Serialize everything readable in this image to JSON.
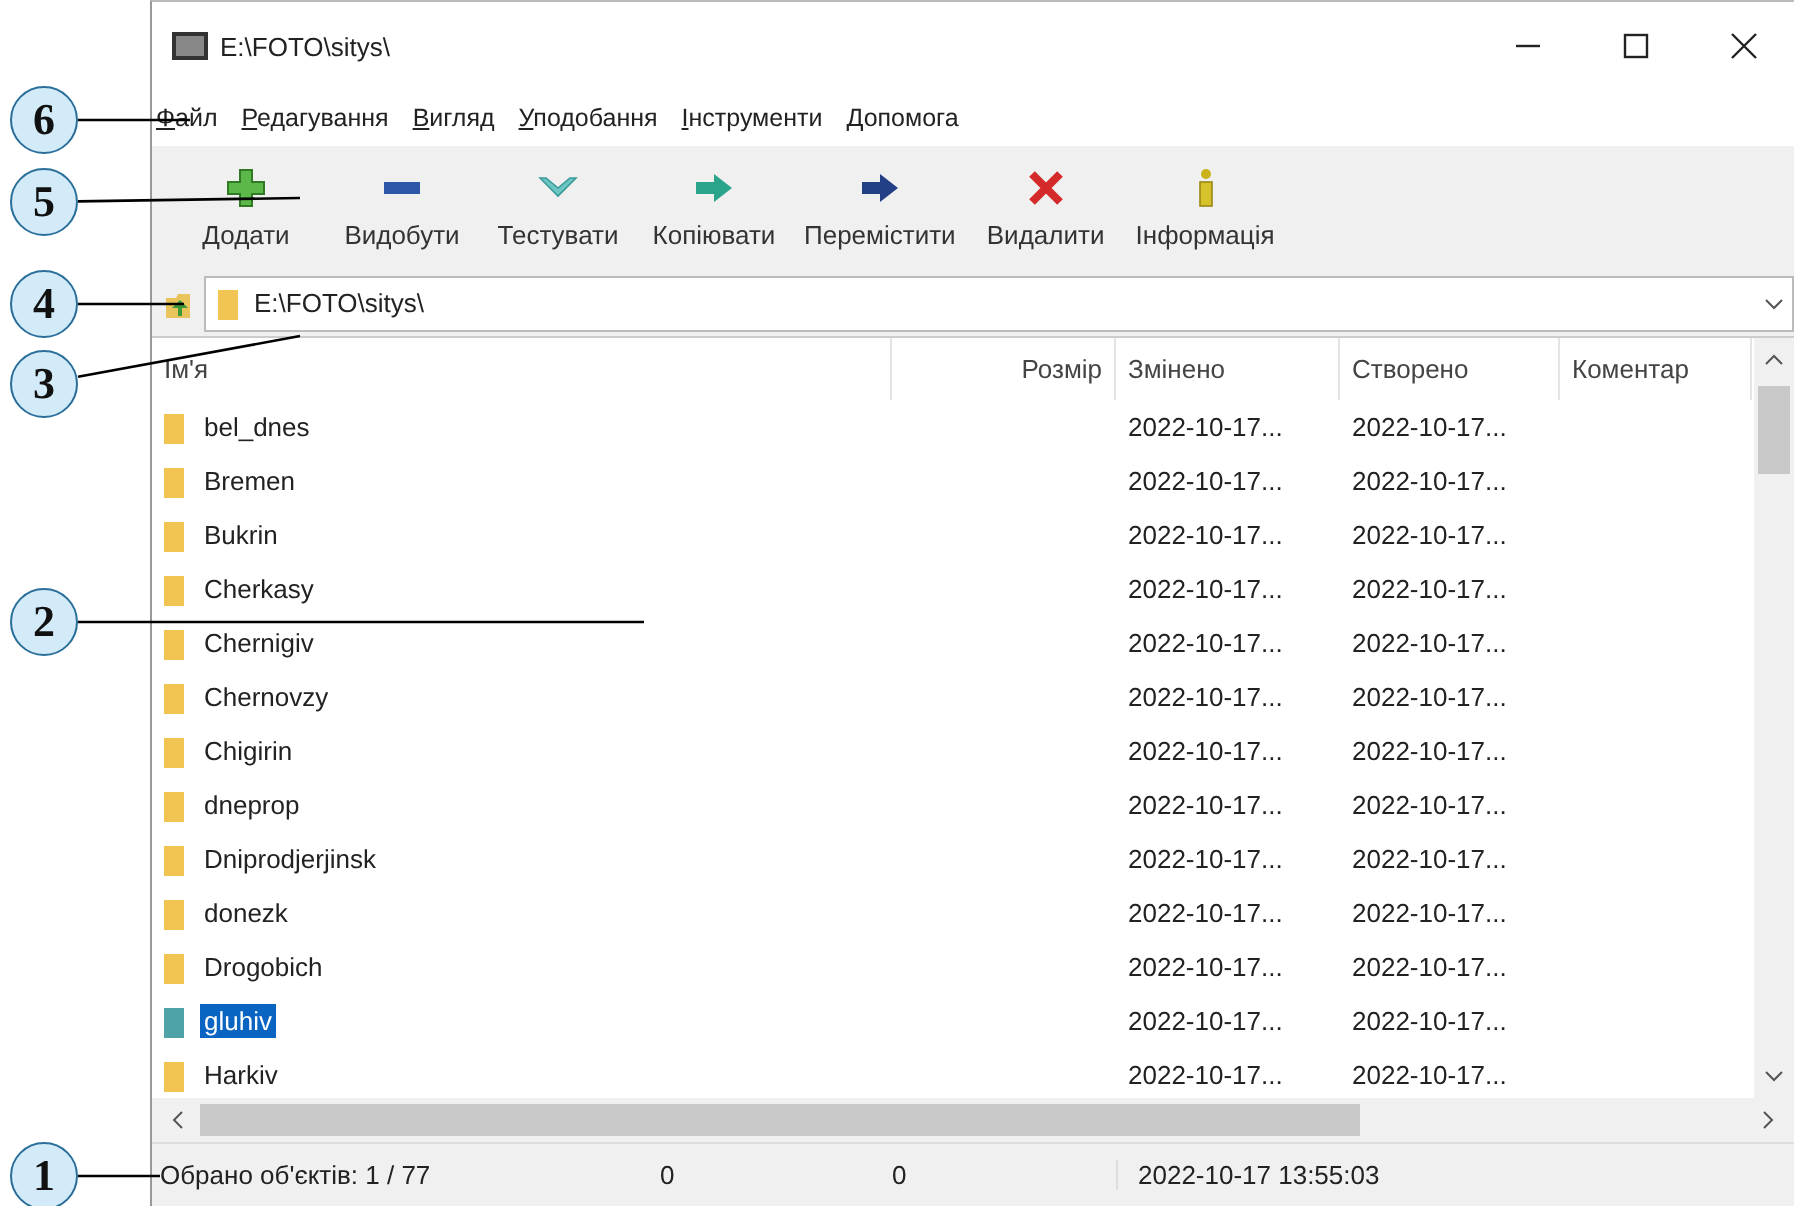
{
  "window": {
    "title": "E:\\FOTO\\sitys\\"
  },
  "menu": [
    {
      "label": "Файл"
    },
    {
      "label": "Редагування"
    },
    {
      "label": "Вигляд"
    },
    {
      "label": "Уподобання"
    },
    {
      "label": "Інструменти"
    },
    {
      "label": "Допомога"
    }
  ],
  "toolbar": [
    {
      "kind": "add",
      "label": "Додати"
    },
    {
      "kind": "extract",
      "label": "Видобути"
    },
    {
      "kind": "test",
      "label": "Тестувати"
    },
    {
      "kind": "copy",
      "label": "Копіювати"
    },
    {
      "kind": "move",
      "label": "Перемістити"
    },
    {
      "kind": "delete",
      "label": "Видалити"
    },
    {
      "kind": "info",
      "label": "Інформація"
    }
  ],
  "address": {
    "value": "E:\\FOTO\\sitys\\"
  },
  "table": {
    "columns": [
      "Ім'я",
      "Розмір",
      "Змінено",
      "Створено",
      "Коментар"
    ],
    "rows": [
      {
        "name": "bel_dnes",
        "modified": "2022-10-17...",
        "created": "2022-10-17...",
        "selected": false
      },
      {
        "name": "Bremen",
        "modified": "2022-10-17...",
        "created": "2022-10-17...",
        "selected": false
      },
      {
        "name": "Bukrin",
        "modified": "2022-10-17...",
        "created": "2022-10-17...",
        "selected": false
      },
      {
        "name": "Cherkasy",
        "modified": "2022-10-17...",
        "created": "2022-10-17...",
        "selected": false
      },
      {
        "name": "Chernigiv",
        "modified": "2022-10-17...",
        "created": "2022-10-17...",
        "selected": false
      },
      {
        "name": "Chernovzy",
        "modified": "2022-10-17...",
        "created": "2022-10-17...",
        "selected": false
      },
      {
        "name": "Chigirin",
        "modified": "2022-10-17...",
        "created": "2022-10-17...",
        "selected": false
      },
      {
        "name": "dneprop",
        "modified": "2022-10-17...",
        "created": "2022-10-17...",
        "selected": false
      },
      {
        "name": "Dniprodjerjinsk",
        "modified": "2022-10-17...",
        "created": "2022-10-17...",
        "selected": false
      },
      {
        "name": "donezk",
        "modified": "2022-10-17...",
        "created": "2022-10-17...",
        "selected": false
      },
      {
        "name": "Drogobich",
        "modified": "2022-10-17...",
        "created": "2022-10-17...",
        "selected": false
      },
      {
        "name": "gluhiv",
        "modified": "2022-10-17...",
        "created": "2022-10-17...",
        "selected": true
      },
      {
        "name": "Harkiv",
        "modified": "2022-10-17...",
        "created": "2022-10-17...",
        "selected": false
      }
    ]
  },
  "status_bar": [
    "Обрано об'єктів: 1 / 77",
    "0",
    "0",
    "2022-10-17 13:55:03"
  ],
  "callouts": [
    "6",
    "5",
    "4",
    "3",
    "2",
    "1"
  ]
}
